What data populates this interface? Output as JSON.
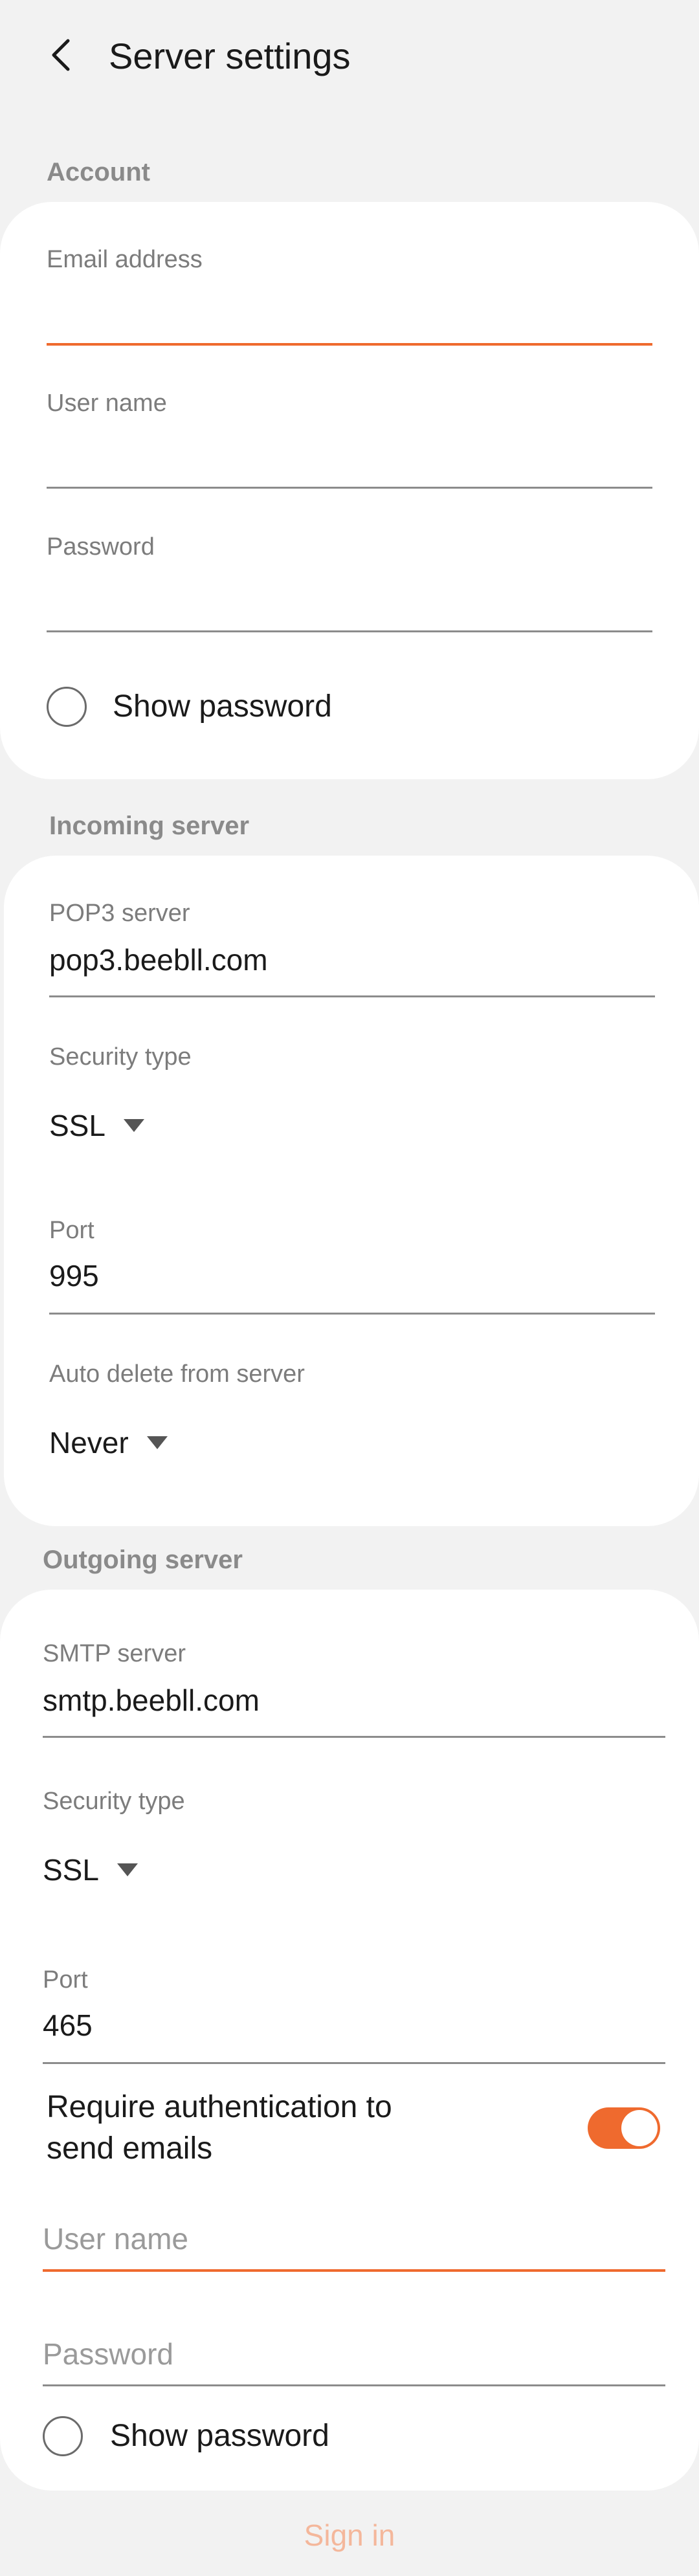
{
  "header": {
    "title": "Server settings",
    "back_icon": "chevron-left-icon"
  },
  "account": {
    "heading": "Account",
    "email_label": "Email address",
    "email_value": "",
    "username_label": "User name",
    "username_value": "",
    "password_label": "Password",
    "password_value": "",
    "show_password_label": "Show password",
    "show_password_checked": false
  },
  "incoming": {
    "heading": "Incoming server",
    "pop3_label": "POP3 server",
    "pop3_value": "pop3.beebll.com",
    "security_label": "Security type",
    "security_value": "SSL",
    "port_label": "Port",
    "port_value": "995",
    "autodelete_label": "Auto delete from server",
    "autodelete_value": "Never"
  },
  "outgoing": {
    "heading": "Outgoing server",
    "smtp_label": "SMTP server",
    "smtp_value": "smtp.beebll.com",
    "security_label": "Security type",
    "security_value": "SSL",
    "port_label": "Port",
    "port_value": "465",
    "auth_label_line1": "Require authentication to",
    "auth_label_line2": "send emails",
    "auth_enabled": true,
    "username_placeholder": "User name",
    "password_placeholder": "Password",
    "show_password_label": "Show password",
    "show_password_checked": false
  },
  "footer": {
    "sign_in_label": "Sign in"
  },
  "colors": {
    "accent": "#ef6a2e",
    "background": "#f2f2f2",
    "card": "#ffffff",
    "disabled_accent": "#f4b79b"
  }
}
